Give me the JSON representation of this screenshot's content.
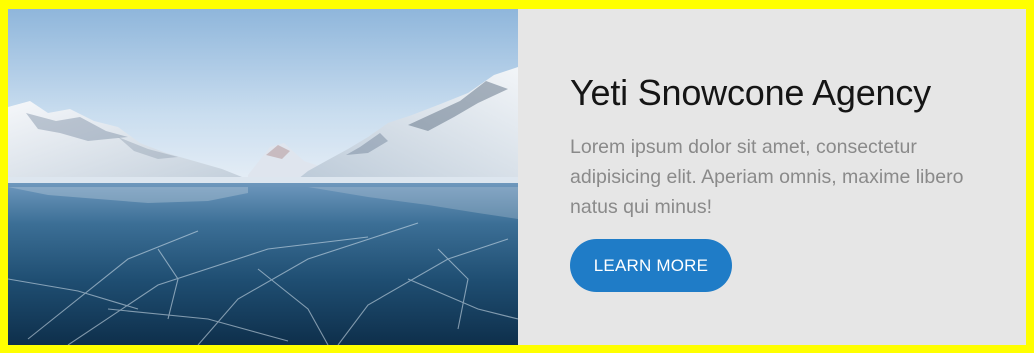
{
  "card": {
    "title": "Yeti Snowcone Agency",
    "description": "Lorem ipsum dolor sit amet, consectetur adipisicing elit. Aperiam omnis, maxime libero natus qui minus!",
    "cta_label": "LEARN MORE"
  },
  "colors": {
    "frame": "#ffff00",
    "card_background": "#e6e6e6",
    "button": "#1f7cc7",
    "title": "#151515",
    "body_text": "#8a8a8a"
  }
}
